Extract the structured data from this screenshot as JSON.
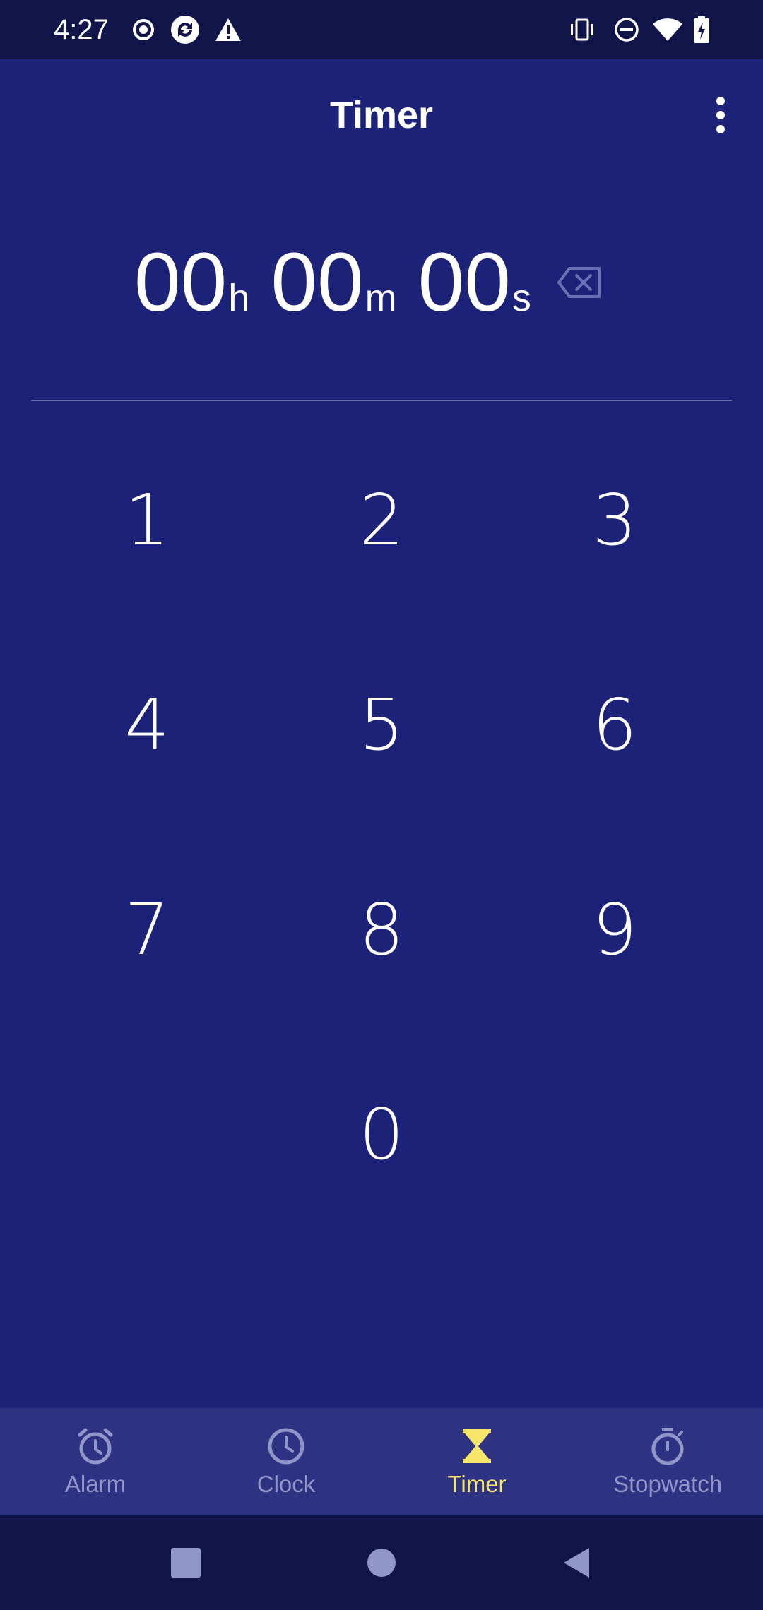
{
  "status_bar": {
    "time": "4:27",
    "left_icons": [
      "record-icon",
      "sync-icon",
      "warning-icon"
    ],
    "right_icons": [
      "vibrate-icon",
      "do-not-disturb-icon",
      "wifi-icon",
      "battery-charging-icon"
    ]
  },
  "app_bar": {
    "title": "Timer",
    "overflow_icon": "more-vert-icon"
  },
  "timer_display": {
    "hours": "00",
    "hours_unit": "h",
    "minutes": "00",
    "minutes_unit": "m",
    "seconds": "00",
    "seconds_unit": "s",
    "backspace_icon": "backspace-icon"
  },
  "keypad": {
    "keys": [
      "1",
      "2",
      "3",
      "4",
      "5",
      "6",
      "7",
      "8",
      "9",
      "0"
    ]
  },
  "bottom_nav": {
    "items": [
      {
        "label": "Alarm",
        "icon": "alarm-icon",
        "active": false
      },
      {
        "label": "Clock",
        "icon": "clock-icon",
        "active": false
      },
      {
        "label": "Timer",
        "icon": "hourglass-icon",
        "active": true
      },
      {
        "label": "Stopwatch",
        "icon": "stopwatch-icon",
        "active": false
      }
    ]
  },
  "system_nav": {
    "buttons": [
      "recents-icon",
      "home-icon",
      "back-icon"
    ]
  },
  "colors": {
    "background": "#1c2278",
    "status_bar": "#11154a",
    "bottom_nav": "#2d3283",
    "active_accent": "#f5e56b",
    "inactive": "#9096c8"
  }
}
